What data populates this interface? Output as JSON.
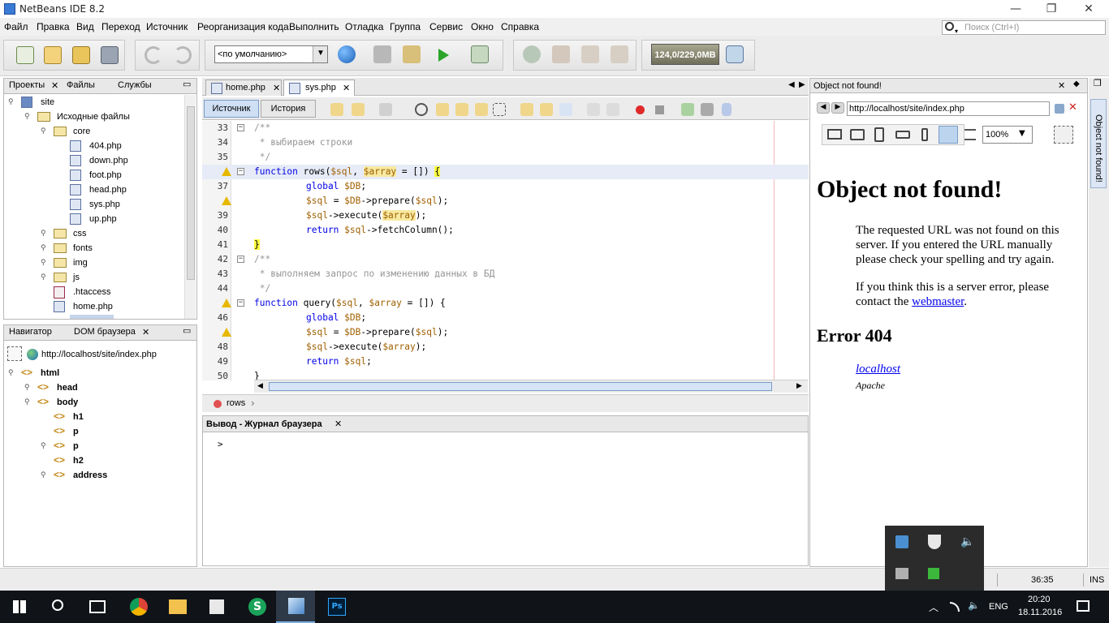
{
  "window": {
    "title": "NetBeans IDE 8.2",
    "min": "—",
    "max": "❐",
    "close": "✕"
  },
  "menu": [
    "Файл",
    "Правка",
    "Вид",
    "Переход",
    "Источник",
    "Реорганизация кода",
    "Выполнить",
    "Отладка",
    "Группа",
    "Сервис",
    "Окно",
    "Справка"
  ],
  "search": {
    "placeholder": "Поиск (Ctrl+I)"
  },
  "toolbar": {
    "config": "<по умолчанию>",
    "memory": "124,0/229,0MB"
  },
  "projects": {
    "tabs": [
      "Проекты",
      "Файлы",
      "Службы"
    ],
    "close": "✕",
    "tree": [
      {
        "label": "site"
      },
      {
        "label": "Исходные файлы"
      },
      {
        "label": "core"
      },
      {
        "label": "404.php"
      },
      {
        "label": "down.php"
      },
      {
        "label": "foot.php"
      },
      {
        "label": "head.php"
      },
      {
        "label": "sys.php"
      },
      {
        "label": "up.php"
      },
      {
        "label": "css"
      },
      {
        "label": "fonts"
      },
      {
        "label": "img"
      },
      {
        "label": "js"
      },
      {
        "label": ".htaccess"
      },
      {
        "label": "home.php"
      }
    ]
  },
  "navigator": {
    "tabs": [
      "Навигатор",
      "DOM браузера"
    ],
    "close": "✕",
    "url": "http://localhost/site/index.php",
    "tree": [
      "html",
      "head",
      "body",
      "h1",
      "p",
      "p",
      "h2",
      "address"
    ]
  },
  "editor": {
    "tabs": [
      "home.php",
      "sys.php"
    ],
    "close": "✕",
    "subtabs": [
      "Источник",
      "История"
    ],
    "lines": [
      {
        "n": "33",
        "text": "/**"
      },
      {
        "n": "34",
        "text": " * выбираем строки"
      },
      {
        "n": "35",
        "text": " */"
      },
      {
        "n": "",
        "text": "function rows($sql, $array = []) {"
      },
      {
        "n": "37",
        "text": "global $DB;"
      },
      {
        "n": "",
        "text": "$sql = $DB->prepare($sql);"
      },
      {
        "n": "39",
        "text": "$sql->execute($array);"
      },
      {
        "n": "40",
        "text": "return $sql->fetchColumn();"
      },
      {
        "n": "41",
        "text": "}"
      },
      {
        "n": "42",
        "text": "/**"
      },
      {
        "n": "43",
        "text": " * выполняем запрос по изменению данных в БД"
      },
      {
        "n": "44",
        "text": " */"
      },
      {
        "n": "",
        "text": "function query($sql, $array = []) {"
      },
      {
        "n": "46",
        "text": "global $DB;"
      },
      {
        "n": "",
        "text": "$sql = $DB->prepare($sql);"
      },
      {
        "n": "48",
        "text": "$sql->execute($array);"
      },
      {
        "n": "49",
        "text": "return $sql;"
      },
      {
        "n": "50",
        "text": "}"
      }
    ],
    "breadcrumb": "rows"
  },
  "output": {
    "title": "Вывод - Журнал браузера",
    "close": "✕",
    "prompt": ">"
  },
  "browser": {
    "tab_title": "Object not found!",
    "close": "✕",
    "url": "http://localhost/site/index.php",
    "zoom": "100%",
    "h1": "Object not found!",
    "p1": "The requested URL was not found on this server. If you entered the URL manually please check your spelling and try again.",
    "p2_pre": "If you think this is a server error, please contact the ",
    "p2_link": "webmaster",
    "p2_post": ".",
    "h2": "Error 404",
    "address_link": "localhost",
    "address_server": "Apache",
    "side_label": "Object not found!"
  },
  "status": {
    "position": "36:35",
    "mode": "INS"
  },
  "taskbar": {
    "lang": "ENG",
    "time": "20:20",
    "date": "18.11.2016"
  }
}
